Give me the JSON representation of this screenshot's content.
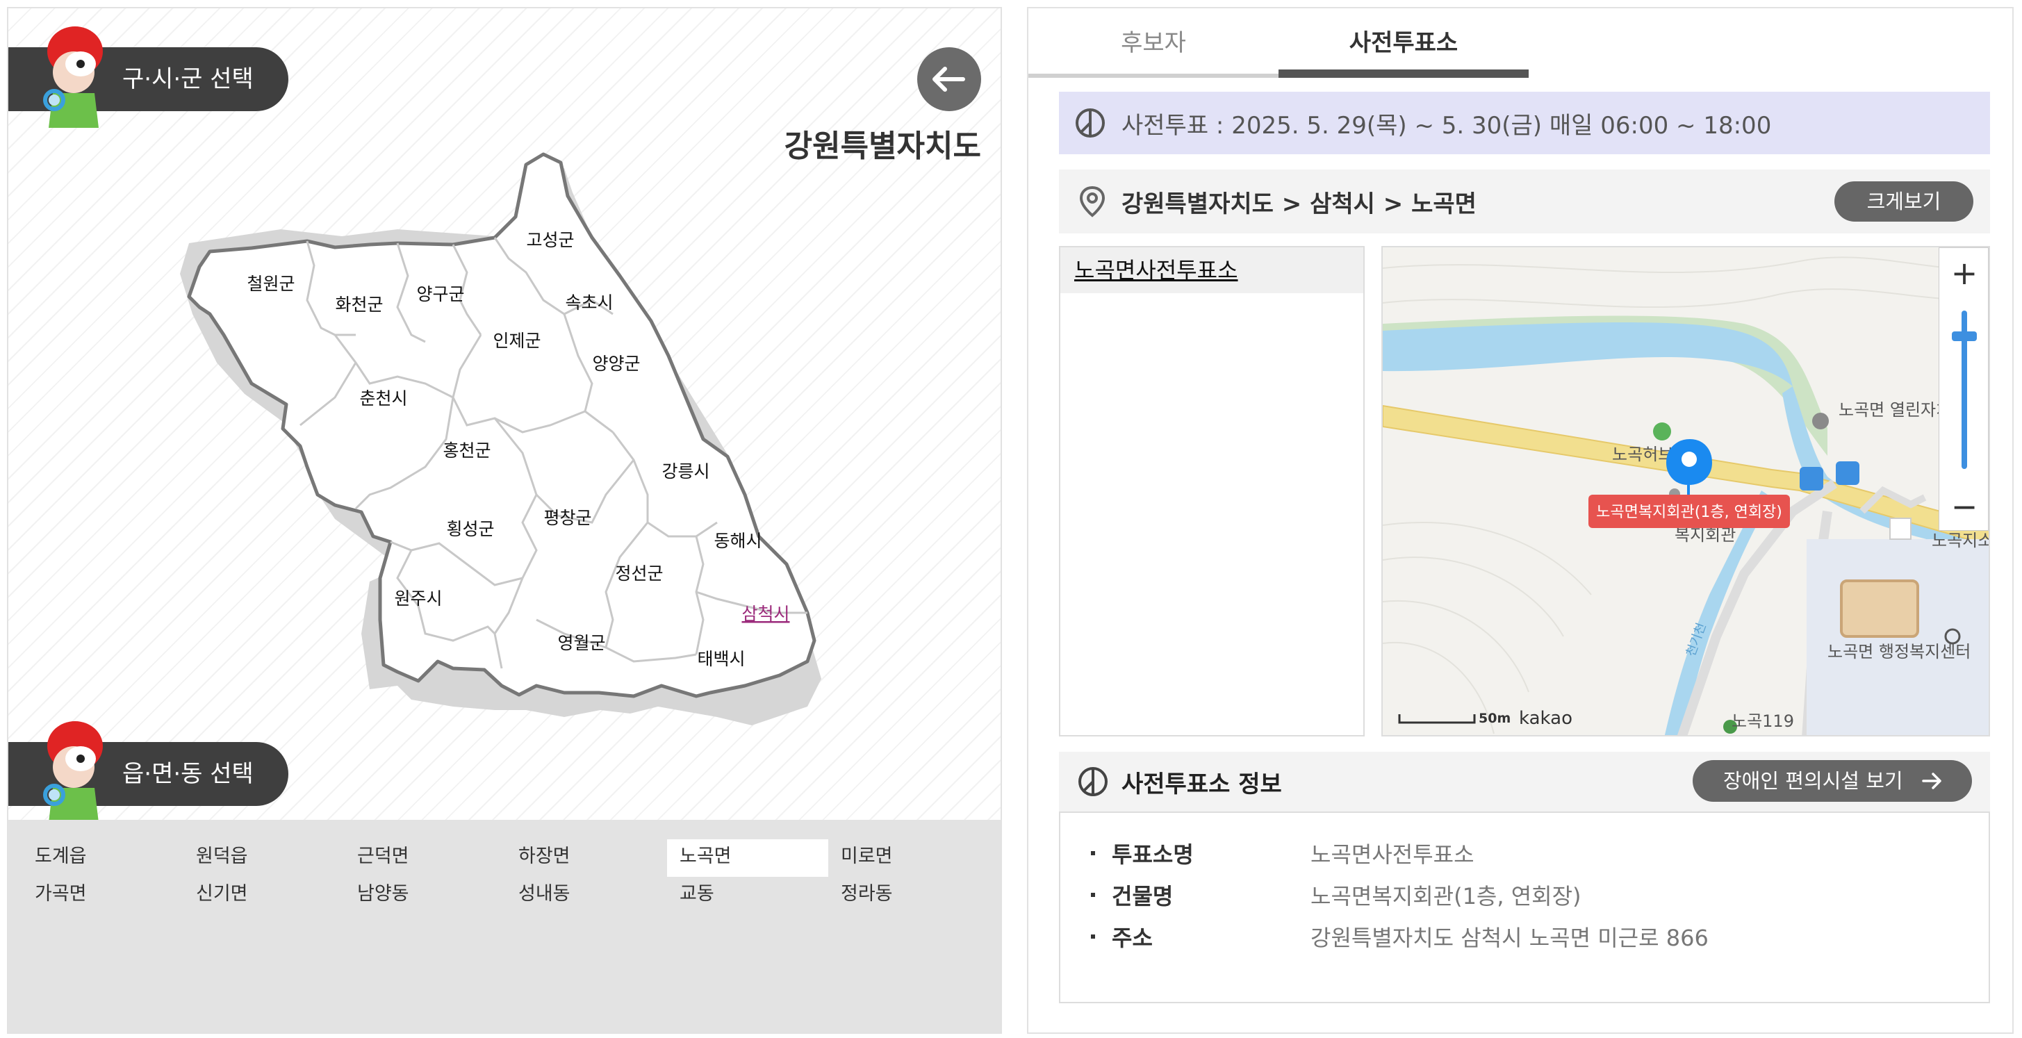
{
  "left": {
    "district_select_label": "구·시·군 선택",
    "dong_select_label": "읍·면·동 선택",
    "province": "강원특별자치도",
    "districts": [
      "철원군",
      "화천군",
      "양구군",
      "고성군",
      "속초시",
      "인제군",
      "양양군",
      "춘천시",
      "홍천군",
      "강릉시",
      "횡성군",
      "평창군",
      "동해시",
      "정선군",
      "원주시",
      "삼척시",
      "영월군",
      "태백시"
    ],
    "selected_district": "삼척시",
    "dongs": [
      [
        "도계읍",
        "원덕읍",
        "근덕면",
        "하장면",
        "노곡면",
        "미로면"
      ],
      [
        "가곡면",
        "신기면",
        "남양동",
        "성내동",
        "교동",
        "정라동"
      ]
    ],
    "selected_dong": "노곡면"
  },
  "right": {
    "tabs": [
      "후보자",
      "사전투표소"
    ],
    "active_tab": "사전투표소",
    "banner": "사전투표 : 2025. 5. 29(목) ~ 5. 30(금) 매일 06:00 ~ 18:00",
    "location": "강원특별자치도 > 삼척시 > 노곡면",
    "view_larger": "크게보기",
    "poll_list": [
      "노곡면사전투표소"
    ],
    "map": {
      "marker_label": "노곡면복지회관(1층, 연회장)",
      "labels": [
        "노곡면 열린자치센터",
        "노곡허브",
        "복지회관",
        "노곡면 행정복지센터",
        "노곡119",
        "천기천",
        "노곡지소"
      ],
      "scale": "50m",
      "brand": "kakao",
      "zoom_level": 0.94
    },
    "info_title": "사전투표소 정보",
    "facility_button": "장애인 편의시설 보기",
    "info_rows": [
      {
        "key": "투표소명",
        "value": "노곡면사전투표소"
      },
      {
        "key": "건물명",
        "value": "노곡면복지회관(1층, 연회장)"
      },
      {
        "key": "주소",
        "value": "강원특별자치도 삼척시 노곡면 미근로 866"
      }
    ]
  },
  "colors": {
    "accent": "#444444",
    "banner_bg": "#e2e2f7",
    "selected_district": "#9b2a7b",
    "marker": "#1a8af0",
    "marker_label_bg": "#e7534f"
  }
}
